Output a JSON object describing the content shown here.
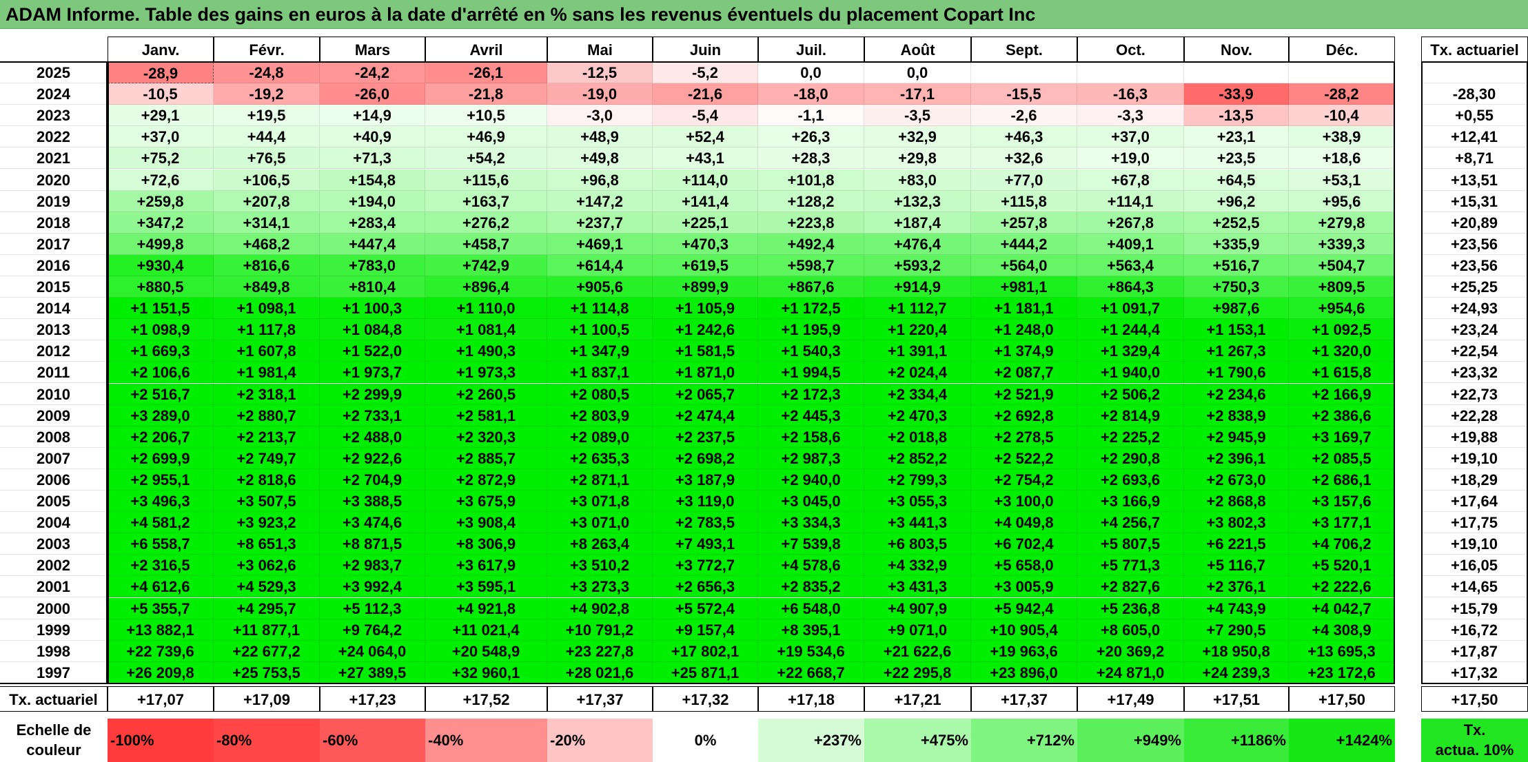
{
  "title": "ADAM Informe. Table des gains en euros à la date d'arrêté en % sans les revenus éventuels du placement Copart Inc",
  "months": [
    "Janv.",
    "Févr.",
    "Mars",
    "Avril",
    "Mai",
    "Juin",
    "Juil.",
    "Août",
    "Sept.",
    "Oct.",
    "Nov.",
    "Déc."
  ],
  "rate_header": "Tx. actuariel",
  "footer_label": "Tx. actuariel",
  "footer_values": [
    "+17,07",
    "+17,09",
    "+17,23",
    "+17,52",
    "+17,37",
    "+17,32",
    "+17,18",
    "+17,21",
    "+17,37",
    "+17,49",
    "+17,51",
    "+17,50"
  ],
  "footer_rate": "+17,50",
  "rows": [
    {
      "year": "2025",
      "values": [
        "-28,9",
        "-24,8",
        "-24,2",
        "-26,1",
        "-12,5",
        "-5,2",
        "0,0",
        "0,0",
        "",
        "",
        "",
        ""
      ],
      "rate": ""
    },
    {
      "year": "2024",
      "values": [
        "-10,5",
        "-19,2",
        "-26,0",
        "-21,8",
        "-19,0",
        "-21,6",
        "-18,0",
        "-17,1",
        "-15,5",
        "-16,3",
        "-33,9",
        "-28,2"
      ],
      "rate": "-28,30"
    },
    {
      "year": "2023",
      "values": [
        "+29,1",
        "+19,5",
        "+14,9",
        "+10,5",
        "-3,0",
        "-5,4",
        "-1,1",
        "-3,5",
        "-2,6",
        "-3,3",
        "-13,5",
        "-10,4"
      ],
      "rate": "+0,55"
    },
    {
      "year": "2022",
      "values": [
        "+37,0",
        "+44,4",
        "+40,9",
        "+46,9",
        "+48,9",
        "+52,4",
        "+26,3",
        "+32,9",
        "+46,3",
        "+37,0",
        "+23,1",
        "+38,9"
      ],
      "rate": "+12,41"
    },
    {
      "year": "2021",
      "values": [
        "+75,2",
        "+76,5",
        "+71,3",
        "+54,2",
        "+49,8",
        "+43,1",
        "+28,3",
        "+29,8",
        "+32,6",
        "+19,0",
        "+23,5",
        "+18,6"
      ],
      "rate": "+8,71"
    },
    {
      "year": "2020",
      "values": [
        "+72,6",
        "+106,5",
        "+154,8",
        "+115,6",
        "+96,8",
        "+114,0",
        "+101,8",
        "+83,0",
        "+77,0",
        "+67,8",
        "+64,5",
        "+53,1"
      ],
      "rate": "+13,51"
    },
    {
      "year": "2019",
      "values": [
        "+259,8",
        "+207,8",
        "+194,0",
        "+163,7",
        "+147,2",
        "+141,4",
        "+128,2",
        "+132,3",
        "+115,8",
        "+114,1",
        "+96,2",
        "+95,6"
      ],
      "rate": "+15,31"
    },
    {
      "year": "2018",
      "values": [
        "+347,2",
        "+314,1",
        "+283,4",
        "+276,2",
        "+237,7",
        "+225,1",
        "+223,8",
        "+187,4",
        "+257,8",
        "+267,8",
        "+252,5",
        "+279,8"
      ],
      "rate": "+20,89"
    },
    {
      "year": "2017",
      "values": [
        "+499,8",
        "+468,2",
        "+447,4",
        "+458,7",
        "+469,1",
        "+470,3",
        "+492,4",
        "+476,4",
        "+444,2",
        "+409,1",
        "+335,9",
        "+339,3"
      ],
      "rate": "+23,56"
    },
    {
      "year": "2016",
      "values": [
        "+930,4",
        "+816,6",
        "+783,0",
        "+742,9",
        "+614,4",
        "+619,5",
        "+598,7",
        "+593,2",
        "+564,0",
        "+563,4",
        "+516,7",
        "+504,7"
      ],
      "rate": "+23,56"
    },
    {
      "year": "2015",
      "values": [
        "+880,5",
        "+849,8",
        "+810,4",
        "+896,4",
        "+905,6",
        "+899,9",
        "+867,6",
        "+914,9",
        "+981,1",
        "+864,3",
        "+750,3",
        "+809,5"
      ],
      "rate": "+25,25"
    },
    {
      "year": "2014",
      "values": [
        "+1 151,5",
        "+1 098,1",
        "+1 100,3",
        "+1 110,0",
        "+1 114,8",
        "+1 105,9",
        "+1 172,5",
        "+1 112,7",
        "+1 181,1",
        "+1 091,7",
        "+987,6",
        "+954,6"
      ],
      "rate": "+24,93"
    },
    {
      "year": "2013",
      "values": [
        "+1 098,9",
        "+1 117,8",
        "+1 084,8",
        "+1 081,4",
        "+1 100,5",
        "+1 242,6",
        "+1 195,9",
        "+1 220,4",
        "+1 248,0",
        "+1 244,4",
        "+1 153,1",
        "+1 092,5"
      ],
      "rate": "+23,24"
    },
    {
      "year": "2012",
      "values": [
        "+1 669,3",
        "+1 607,8",
        "+1 522,0",
        "+1 490,3",
        "+1 347,9",
        "+1 581,5",
        "+1 540,3",
        "+1 391,1",
        "+1 374,9",
        "+1 329,4",
        "+1 267,3",
        "+1 320,0"
      ],
      "rate": "+22,54"
    },
    {
      "year": "2011",
      "values": [
        "+2 106,6",
        "+1 981,4",
        "+1 973,7",
        "+1 973,3",
        "+1 837,1",
        "+1 871,0",
        "+1 994,5",
        "+2 024,4",
        "+2 087,7",
        "+1 940,0",
        "+1 790,6",
        "+1 615,8"
      ],
      "rate": "+23,32"
    },
    {
      "year": "2010",
      "values": [
        "+2 516,7",
        "+2 318,1",
        "+2 299,9",
        "+2 260,5",
        "+2 080,5",
        "+2 065,7",
        "+2 172,3",
        "+2 334,4",
        "+2 521,9",
        "+2 506,2",
        "+2 234,6",
        "+2 166,9"
      ],
      "rate": "+22,73"
    },
    {
      "year": "2009",
      "values": [
        "+3 289,0",
        "+2 880,7",
        "+2 733,1",
        "+2 581,1",
        "+2 803,9",
        "+2 474,4",
        "+2 445,3",
        "+2 470,3",
        "+2 692,8",
        "+2 814,9",
        "+2 838,9",
        "+2 386,6"
      ],
      "rate": "+22,28"
    },
    {
      "year": "2008",
      "values": [
        "+2 206,7",
        "+2 213,7",
        "+2 488,0",
        "+2 320,3",
        "+2 089,0",
        "+2 237,5",
        "+2 158,6",
        "+2 018,8",
        "+2 278,5",
        "+2 225,2",
        "+2 945,9",
        "+3 169,7"
      ],
      "rate": "+19,88"
    },
    {
      "year": "2007",
      "values": [
        "+2 699,9",
        "+2 749,7",
        "+2 922,6",
        "+2 885,7",
        "+2 635,3",
        "+2 698,2",
        "+2 987,3",
        "+2 852,2",
        "+2 522,2",
        "+2 290,8",
        "+2 396,1",
        "+2 085,5"
      ],
      "rate": "+19,10"
    },
    {
      "year": "2006",
      "values": [
        "+2 955,1",
        "+2 818,6",
        "+2 704,9",
        "+2 872,9",
        "+2 871,1",
        "+3 187,9",
        "+2 940,0",
        "+2 799,3",
        "+2 754,2",
        "+2 693,6",
        "+2 673,0",
        "+2 686,1"
      ],
      "rate": "+18,29"
    },
    {
      "year": "2005",
      "values": [
        "+3 496,3",
        "+3 507,5",
        "+3 388,5",
        "+3 675,9",
        "+3 071,8",
        "+3 119,0",
        "+3 045,0",
        "+3 055,3",
        "+3 100,0",
        "+3 166,9",
        "+2 868,8",
        "+3 157,6"
      ],
      "rate": "+17,64"
    },
    {
      "year": "2004",
      "values": [
        "+4 581,2",
        "+3 923,2",
        "+3 474,6",
        "+3 908,4",
        "+3 071,0",
        "+2 783,5",
        "+3 334,3",
        "+3 441,3",
        "+4 049,8",
        "+4 256,7",
        "+3 802,3",
        "+3 177,1"
      ],
      "rate": "+17,75"
    },
    {
      "year": "2003",
      "values": [
        "+6 558,7",
        "+8 651,3",
        "+8 871,5",
        "+8 306,9",
        "+8 263,4",
        "+7 493,1",
        "+7 539,8",
        "+6 803,5",
        "+6 702,4",
        "+5 807,5",
        "+6 221,5",
        "+4 706,2"
      ],
      "rate": "+19,10"
    },
    {
      "year": "2002",
      "values": [
        "+2 316,5",
        "+3 062,6",
        "+2 983,7",
        "+3 617,9",
        "+3 510,2",
        "+3 772,7",
        "+4 578,6",
        "+4 332,9",
        "+5 658,0",
        "+5 771,3",
        "+5 116,7",
        "+5 520,1"
      ],
      "rate": "+16,05"
    },
    {
      "year": "2001",
      "values": [
        "+4 612,6",
        "+4 529,3",
        "+3 992,4",
        "+3 595,1",
        "+3 273,3",
        "+2 656,3",
        "+2 835,2",
        "+3 431,3",
        "+3 005,9",
        "+2 827,6",
        "+2 376,1",
        "+2 222,6"
      ],
      "rate": "+14,65"
    },
    {
      "year": "2000",
      "values": [
        "+5 355,7",
        "+4 295,7",
        "+5 112,3",
        "+4 921,8",
        "+4 902,8",
        "+5 572,4",
        "+6 548,0",
        "+4 907,9",
        "+5 942,4",
        "+5 236,8",
        "+4 743,9",
        "+4 042,7"
      ],
      "rate": "+15,79"
    },
    {
      "year": "1999",
      "values": [
        "+13 882,1",
        "+11 877,1",
        "+9 764,2",
        "+11 021,4",
        "+10 791,2",
        "+9 157,4",
        "+8 395,1",
        "+9 071,0",
        "+10 905,4",
        "+8 605,0",
        "+7 290,5",
        "+4 308,9"
      ],
      "rate": "+16,72"
    },
    {
      "year": "1998",
      "values": [
        "+22 739,6",
        "+22 677,2",
        "+24 064,0",
        "+20 548,9",
        "+23 227,8",
        "+17 802,1",
        "+19 534,6",
        "+21 622,6",
        "+19 963,6",
        "+20 369,2",
        "+18 950,8",
        "+13 695,3"
      ],
      "rate": "+17,87"
    },
    {
      "year": "1997",
      "values": [
        "+26 209,8",
        "+25 753,5",
        "+27 389,5",
        "+32 960,1",
        "+28 021,6",
        "+25 871,1",
        "+22 668,7",
        "+22 295,8",
        "+23 896,0",
        "+24 871,0",
        "+24 239,3",
        "+23 172,6"
      ],
      "rate": "+17,32"
    }
  ],
  "scale": {
    "label_line1": "Echelle de",
    "label_line2": "couleur",
    "items": [
      {
        "text": "-100%",
        "color": "#ff3b3b",
        "align": "left"
      },
      {
        "text": "-80%",
        "color": "#ff4747",
        "align": "left"
      },
      {
        "text": "-60%",
        "color": "#ff5858",
        "align": "left"
      },
      {
        "text": "-40%",
        "color": "#ff8f8f",
        "align": "left"
      },
      {
        "text": "-20%",
        "color": "#ffc4c4",
        "align": "left"
      },
      {
        "text": "0%",
        "color": "#ffffff",
        "align": "center"
      },
      {
        "text": "+237%",
        "color": "#d6fcd6",
        "align": "right"
      },
      {
        "text": "+475%",
        "color": "#aaf8aa",
        "align": "right"
      },
      {
        "text": "+712%",
        "color": "#80f480",
        "align": "right"
      },
      {
        "text": "+949%",
        "color": "#5cf05c",
        "align": "right"
      },
      {
        "text": "+1186%",
        "color": "#3aec3a",
        "align": "right"
      },
      {
        "text": "+1424%",
        "color": "#16e816",
        "align": "right"
      }
    ],
    "rate_line1": "Tx.",
    "rate_line2": "actua. 10%",
    "rate_color": "#22e622"
  },
  "colors": {
    "title_bg": "#7ec87e",
    "bright_green": "#00ee00"
  }
}
